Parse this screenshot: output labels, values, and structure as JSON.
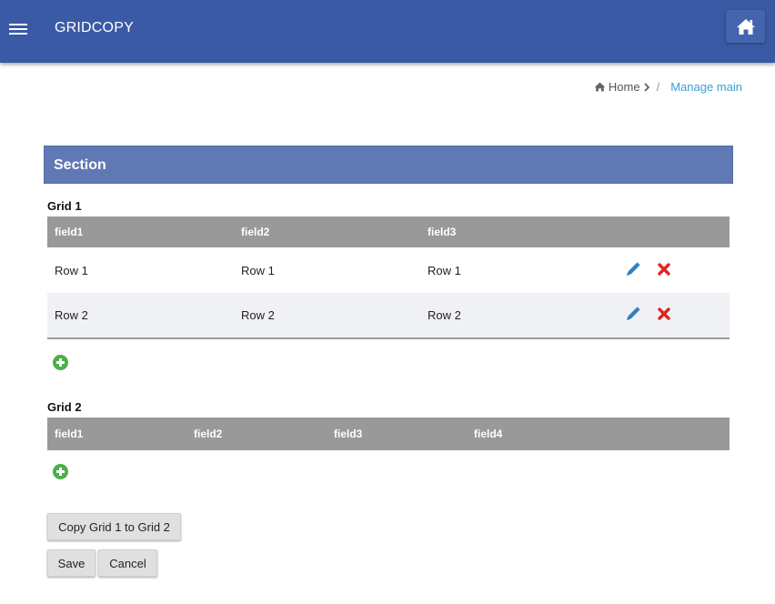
{
  "header": {
    "title": "GRIDCOPY",
    "menu_icon": "hamburger-menu-icon",
    "home_icon": "home-icon",
    "bar_color": "#3a5aa5"
  },
  "breadcrumb": {
    "home_label": "Home",
    "separator": "/",
    "current_label": "Manage main",
    "link_color": "#3c9dd8"
  },
  "section": {
    "title": "Section",
    "header_color": "#6079b4"
  },
  "grid1": {
    "title": "Grid 1",
    "columns": [
      "field1",
      "field2",
      "field3"
    ],
    "rows": [
      [
        "Row 1",
        "Row 1",
        "Row 1"
      ],
      [
        "Row 2",
        "Row 2",
        "Row 2"
      ]
    ],
    "edit_icon": "pencil-icon",
    "delete_icon": "red-x-icon",
    "add_icon": "green-plus-circle-icon"
  },
  "grid2": {
    "title": "Grid 2",
    "columns": [
      "field1",
      "field2",
      "field3",
      "field4"
    ],
    "rows": [],
    "add_icon": "green-plus-circle-icon"
  },
  "buttons": {
    "copy_label": "Copy Grid 1 to Grid 2",
    "save_label": "Save",
    "cancel_label": "Cancel"
  },
  "colors": {
    "grid_header": "#999999",
    "edit_icon": "#2f7fc1",
    "delete_icon": "#e02424",
    "add_icon": "#4cae4c"
  }
}
